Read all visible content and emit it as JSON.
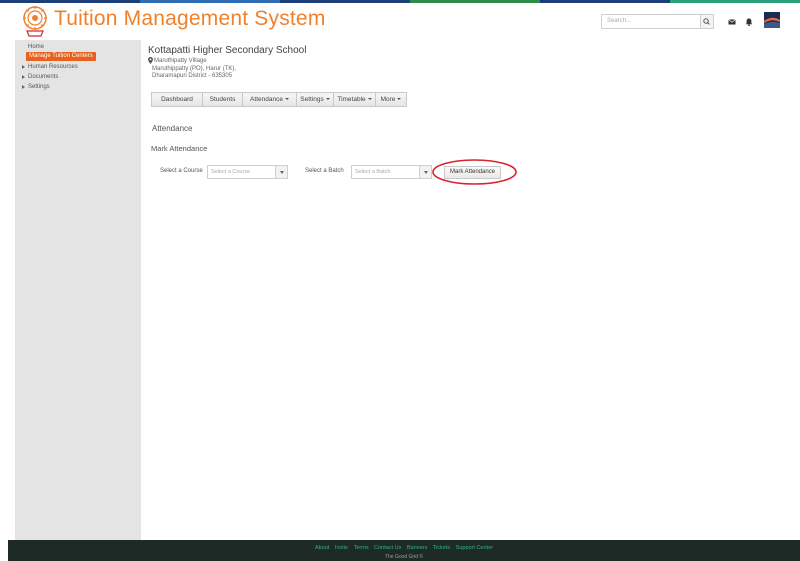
{
  "app": {
    "title": "Tuition Management System",
    "accent_color": "#f0812b",
    "stripe_colors": [
      "#1c3f7a",
      "#2e6db5",
      "#1c3f7a",
      "#2e8b4a",
      "#1c3f7a",
      "#2aa07a"
    ]
  },
  "header": {
    "search_placeholder": "Search...",
    "search_icon": "search-icon",
    "mail_icon": "mail-icon",
    "bell_icon": "bell-icon",
    "avatar_icon": "user-avatar"
  },
  "sidebar": {
    "items": [
      {
        "label": "Home",
        "expandable": false
      },
      {
        "label": "Manage Tuition  Centers",
        "expandable": false,
        "active": true
      },
      {
        "label": "Human Resources",
        "expandable": true
      },
      {
        "label": "Documents",
        "expandable": true
      },
      {
        "label": "Settings",
        "expandable": true
      }
    ]
  },
  "school": {
    "name": "Kottapatti Higher Secondary School",
    "address_lines": [
      "Maruthipatty Village",
      "Maruthippatty (PO), Harur (TK),",
      "Dharamapuri District - 635305"
    ],
    "pin_icon": "map-pin-icon"
  },
  "nav": {
    "tabs": [
      {
        "label": "Dashboard",
        "dropdown": false
      },
      {
        "label": "Students",
        "dropdown": false
      },
      {
        "label": "Attendance",
        "dropdown": true
      },
      {
        "label": "Settings",
        "dropdown": true
      },
      {
        "label": "Timetable",
        "dropdown": true
      },
      {
        "label": "More",
        "dropdown": true
      }
    ]
  },
  "main": {
    "section_title": "Attendance",
    "sub_title": "Mark Attendance",
    "course_label": "Select a Course",
    "course_placeholder": "Select a Course",
    "batch_label": "Select a Batch",
    "batch_placeholder": "Select a Batch",
    "mark_button": "Mark Attendance",
    "highlight_color": "#d9232d"
  },
  "footer": {
    "links": [
      "About",
      "Invite",
      "Terms",
      "Contact Us",
      "Banners",
      "Tickets",
      "Support Center"
    ],
    "copyright": "The Good Grid ©",
    "link_color": "#2fb57a"
  }
}
